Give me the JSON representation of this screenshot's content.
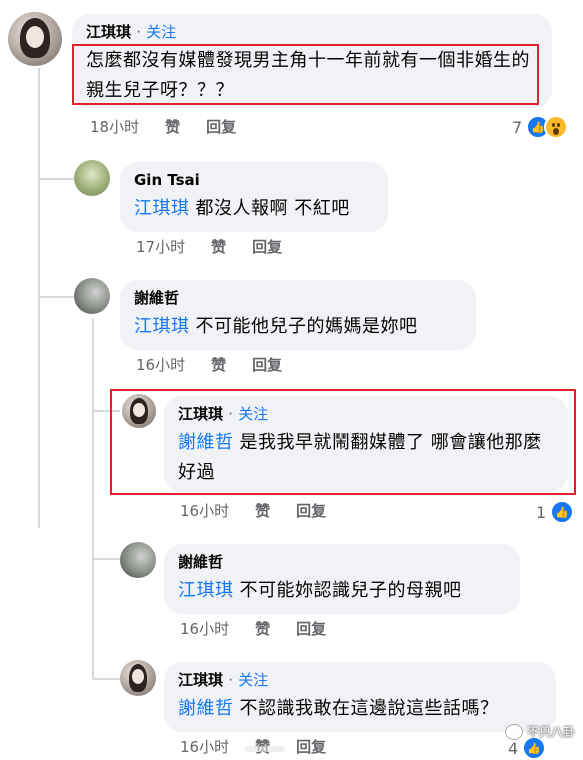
{
  "comments": [
    {
      "author": "江琪琪",
      "follow": "关注",
      "separator": "·",
      "text": "怎麼都沒有媒體發現男主角十一年前就有一個非婚生的親生兒子呀？？？",
      "time": "18小时",
      "like": "赞",
      "reply": "回复",
      "reaction_count": "7"
    },
    {
      "author": "Gin Tsai",
      "mention": "江琪琪",
      "text": "都沒人報啊 不紅吧",
      "time": "17小时",
      "like": "赞",
      "reply": "回复"
    },
    {
      "author": "謝維哲",
      "mention": "江琪琪",
      "text": "不可能他兒子的媽媽是妳吧",
      "time": "16小时",
      "like": "赞",
      "reply": "回复"
    },
    {
      "author": "江琪琪",
      "follow": "关注",
      "separator": "·",
      "mention": "謝維哲",
      "text": "是我我早就鬧翻媒體了 哪會讓他那麼好過",
      "time": "16小时",
      "like": "赞",
      "reply": "回复",
      "reaction_count": "1"
    },
    {
      "author": "謝維哲",
      "mention": "江琪琪",
      "text": "不可能妳認識兒子的母親吧",
      "time": "16小时",
      "like": "赞",
      "reply": "回复"
    },
    {
      "author": "江琪琪",
      "follow": "关注",
      "separator": "·",
      "mention": "謝維哲",
      "text": "不認識我敢在這邊說這些話嗎？",
      "time": "16小时",
      "like": "赞",
      "reply": "回复",
      "reaction_count": "4"
    }
  ],
  "watermark": "不只八卦",
  "colors": {
    "link": "#1877f2",
    "bubble": "#f0f2f5",
    "meta": "#65676b",
    "highlight": "#e0202a"
  }
}
